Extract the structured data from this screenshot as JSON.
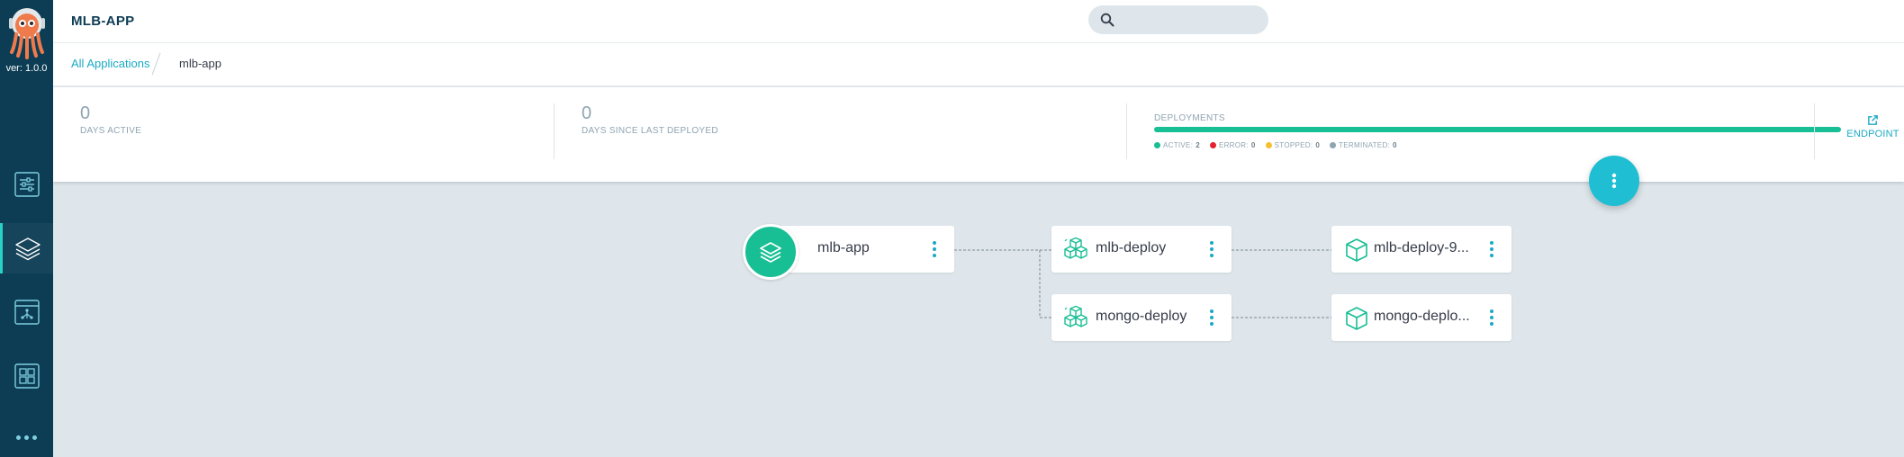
{
  "sidebar": {
    "version": "ver: 1.0.0",
    "items": [
      {
        "icon": "sliders-icon"
      },
      {
        "icon": "layers-icon",
        "active": true
      },
      {
        "icon": "tree-icon"
      },
      {
        "icon": "grid-icon"
      }
    ],
    "more_icon": "more-icon"
  },
  "header": {
    "title": "MLB-APP",
    "search_placeholder": ""
  },
  "breadcrumb": {
    "parent": "All Applications",
    "current": "mlb-app"
  },
  "stats": {
    "days_active": {
      "value": "0",
      "label": "DAYS ACTIVE"
    },
    "days_since_deployed": {
      "value": "0",
      "label": "DAYS SINCE LAST DEPLOYED"
    },
    "deployments": {
      "label": "DEPLOYMENTS",
      "active_fraction": 1.0,
      "legend": [
        {
          "label": "ACTIVE:",
          "count": "2",
          "color": "#18be94"
        },
        {
          "label": "ERROR:",
          "count": "0",
          "color": "#e96d76"
        },
        {
          "label": "STOPPED:",
          "count": "0",
          "color": "#f4c030"
        },
        {
          "label": "TERMINATED:",
          "count": "0",
          "color": "#8fa4b1"
        }
      ]
    },
    "endpoint_label": "ENDPOINT"
  },
  "graph": {
    "app_node": {
      "name": "mlb-app",
      "icon": "layers-icon"
    },
    "deploy_nodes": [
      {
        "name": "mlb-deploy",
        "icon": "cubes-icon"
      },
      {
        "name": "mongo-deploy",
        "icon": "cubes-icon"
      }
    ],
    "pod_nodes": [
      {
        "name": "mlb-deploy-9...",
        "icon": "cube-icon"
      },
      {
        "name": "mongo-deplo...",
        "icon": "cube-icon"
      }
    ]
  },
  "colors": {
    "sidebar": "#0d3d55",
    "accent": "#1aa9c4",
    "healthy": "#18be94",
    "background": "#dee6eb"
  }
}
